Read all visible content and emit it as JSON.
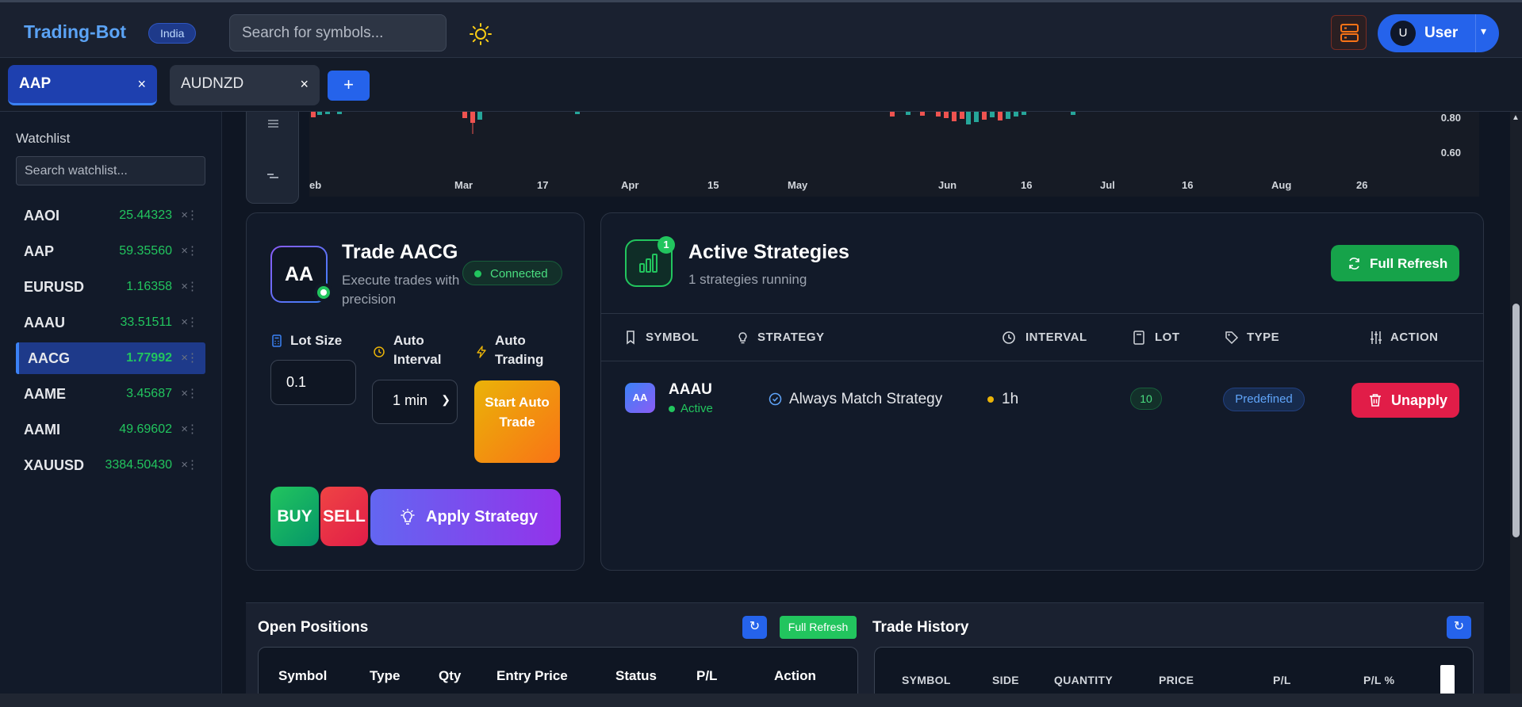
{
  "header": {
    "brand": "Trading-Bot",
    "region_badge": "India",
    "search_placeholder": "Search for symbols...",
    "user_initial": "U",
    "user_name": "User"
  },
  "tabs": [
    {
      "label": "AAP",
      "active": true
    },
    {
      "label": "AUDNZD",
      "active": false
    }
  ],
  "tab_add_label": "+",
  "tab_close_glyph": "×",
  "watchlist": {
    "title": "Watchlist",
    "search_placeholder": "Search watchlist...",
    "remove_glyph": "×",
    "menu_glyph": "⋮",
    "items": [
      {
        "symbol": "AAOI",
        "price": "25.44323"
      },
      {
        "symbol": "AAP",
        "price": "59.35560"
      },
      {
        "symbol": "EURUSD",
        "price": "1.16358"
      },
      {
        "symbol": "AAAU",
        "price": "33.51511"
      },
      {
        "symbol": "AACG",
        "price": "1.77992",
        "selected": true
      },
      {
        "symbol": "AAME",
        "price": "3.45687"
      },
      {
        "symbol": "AAMI",
        "price": "49.69602"
      },
      {
        "symbol": "XAUUSD",
        "price": "3384.50430"
      }
    ]
  },
  "chart": {
    "x_ticks": [
      "eb",
      "Mar",
      "17",
      "Apr",
      "15",
      "May",
      "Jun",
      "16",
      "Jul",
      "16",
      "Aug",
      "26"
    ],
    "y_ticks": [
      "0.80",
      "0.60"
    ],
    "candle_up_color": "#26a69a",
    "candle_down_color": "#ef5350"
  },
  "trade": {
    "avatar": "AA",
    "title": "Trade AACG",
    "subtitle": "Execute trades with precision",
    "status": "Connected",
    "lot_size_label": "Lot Size",
    "lot_size_value": "0.1",
    "auto_interval_label": "Auto Interval",
    "auto_interval_value": "1 min",
    "auto_trading_label": "Auto Trading",
    "start_auto_label": "Start Auto Trade",
    "buy_label": "BUY",
    "sell_label": "SELL",
    "apply_label": "Apply Strategy"
  },
  "strategies": {
    "badge_count": "1",
    "title": "Active Strategies",
    "subtitle": "1 strategies running",
    "full_refresh_label": "Full Refresh",
    "columns": [
      "SYMBOL",
      "STRATEGY",
      "INTERVAL",
      "LOT",
      "TYPE",
      "ACTION"
    ],
    "rows": [
      {
        "avatar": "AA",
        "symbol": "AAAU",
        "status": "Active",
        "strategy": "Always Match Strategy",
        "interval": "1h",
        "lot": "10",
        "type": "Predefined",
        "action": "Unapply"
      }
    ]
  },
  "open_positions": {
    "title": "Open Positions",
    "refresh_glyph": "↻",
    "full_refresh_label": "Full Refresh",
    "columns": [
      "Symbol",
      "Type",
      "Qty",
      "Entry Price",
      "Status",
      "P/L",
      "Action"
    ]
  },
  "trade_history": {
    "title": "Trade History",
    "refresh_glyph": "↻",
    "columns": [
      "SYMBOL",
      "SIDE",
      "QUANTITY",
      "PRICE",
      "P/L",
      "P/L %"
    ]
  },
  "colors": {
    "accent": "#2563eb",
    "positive": "#22c55e",
    "negative": "#e11d48",
    "brand": "#5ba3f5"
  }
}
